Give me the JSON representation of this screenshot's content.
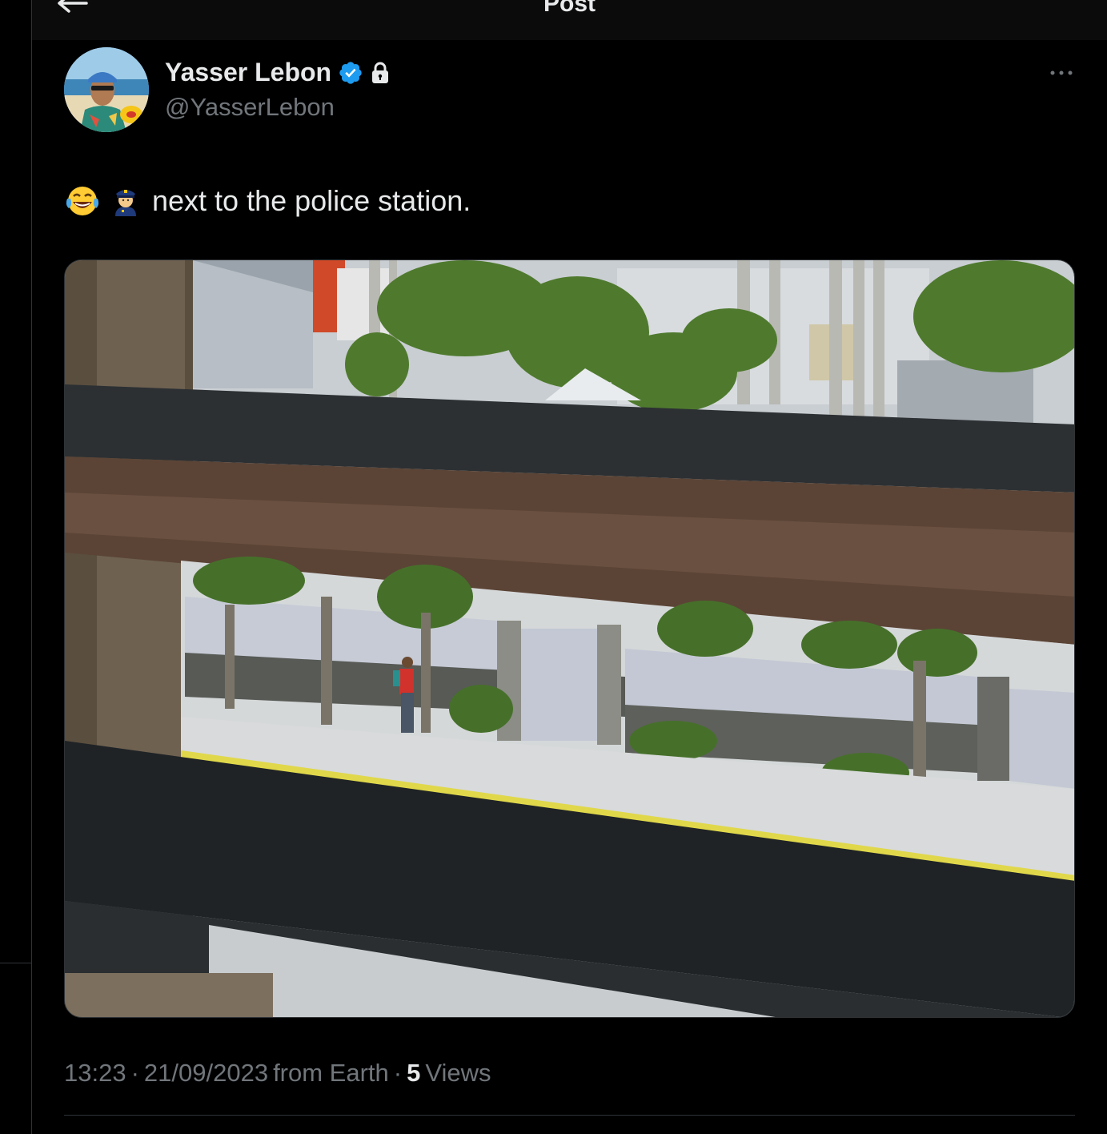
{
  "header": {
    "title": "Post"
  },
  "author": {
    "name": "Yasser Lebon",
    "handle": "@YasserLebon",
    "verified": true,
    "protected": true,
    "verified_color": "#1d9bf0"
  },
  "post": {
    "emojis": [
      "face-with-tears-of-joy",
      "police-officer"
    ],
    "text": "next to the police station."
  },
  "meta": {
    "time": "13:23",
    "sep1": "·",
    "date": "21/09/2023",
    "source": "from Earth",
    "sep2": "·",
    "views_count": "5",
    "views_label": "Views"
  },
  "icons": {
    "back": "arrow-left-icon",
    "more": "ellipsis-icon",
    "verified": "verified-badge-icon",
    "lock": "lock-icon"
  },
  "colors": {
    "background": "#000000",
    "text": "#e7e9ea",
    "muted": "#71767b",
    "border": "#2f3336"
  }
}
